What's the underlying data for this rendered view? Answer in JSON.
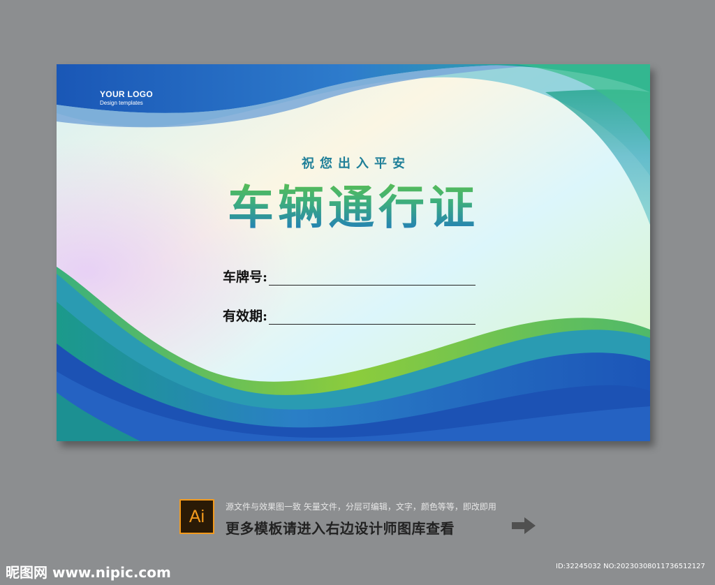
{
  "card": {
    "logo_title": "YOUR LOGO",
    "logo_sub": "Design templates",
    "subtitle": "祝您出入平安",
    "title": "车辆通行证",
    "fields": [
      {
        "label": "车牌号:"
      },
      {
        "label": "有效期:"
      }
    ]
  },
  "footer": {
    "badge": "Ai",
    "note": "源文件与效果图一致 矢量文件，分层可编辑，文字，颜色等等，即改即用",
    "promo": "更多模板请进入右边设计师图库查看"
  },
  "watermark": {
    "site": "昵图网 www.nipic.com",
    "id": "ID:32245032 NO:20230308011736512127"
  },
  "colors": {
    "page_bg": "#8c8e90",
    "blue": "#1e66c0",
    "green": "#69c240",
    "teal": "#1f7f98",
    "badge_orange": "#f39a1d"
  }
}
